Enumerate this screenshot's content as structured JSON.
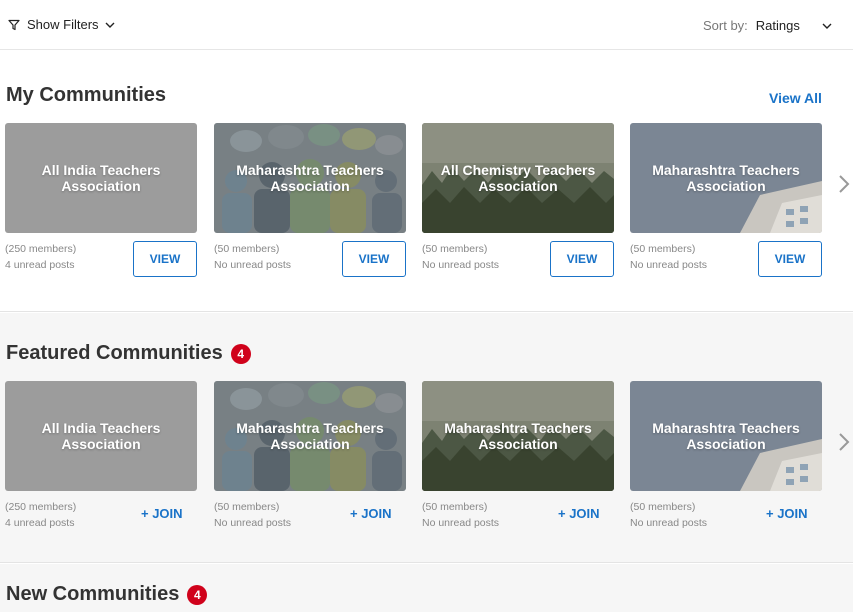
{
  "toolbar": {
    "filters_label": "Show Filters",
    "sort_label": "Sort by:",
    "sort_value": "Ratings"
  },
  "my_communities": {
    "title": "My Communities",
    "view_all_label": "View All",
    "cards": [
      {
        "name": "All India Teachers Association",
        "members": "(250 members)",
        "posts": "4 unread posts",
        "button": "VIEW"
      },
      {
        "name": "Maharashtra Teachers Association",
        "members": "(50 members)",
        "posts": "No unread posts",
        "button": "VIEW"
      },
      {
        "name": "All Chemistry Teachers Association",
        "members": "(50 members)",
        "posts": "No unread posts",
        "button": "VIEW"
      },
      {
        "name": "Maharashtra Teachers Association",
        "members": "(50 members)",
        "posts": "No unread posts",
        "button": "VIEW"
      }
    ]
  },
  "featured_communities": {
    "title": "Featured Communities",
    "badge": "4",
    "cards": [
      {
        "name": "All India Teachers Association",
        "members": "(250 members)",
        "posts": "4 unread posts",
        "button": "+ JOIN"
      },
      {
        "name": "Maharashtra Teachers Association",
        "members": "(50 members)",
        "posts": "No unread posts",
        "button": "+ JOIN"
      },
      {
        "name": "Maharashtra Teachers Association",
        "members": "(50 members)",
        "posts": "No unread posts",
        "button": "+ JOIN"
      },
      {
        "name": "Maharashtra Teachers Association",
        "members": "(50 members)",
        "posts": "No unread posts",
        "button": "+ JOIN"
      }
    ]
  },
  "new_communities": {
    "title": "New Communities",
    "badge": "4"
  },
  "colors": {
    "accent": "#1a73c8",
    "badge": "#d0021b"
  },
  "icons": {
    "filter": "filter-icon",
    "chevron": "chevron-down-icon",
    "next": "chevron-right-icon"
  }
}
